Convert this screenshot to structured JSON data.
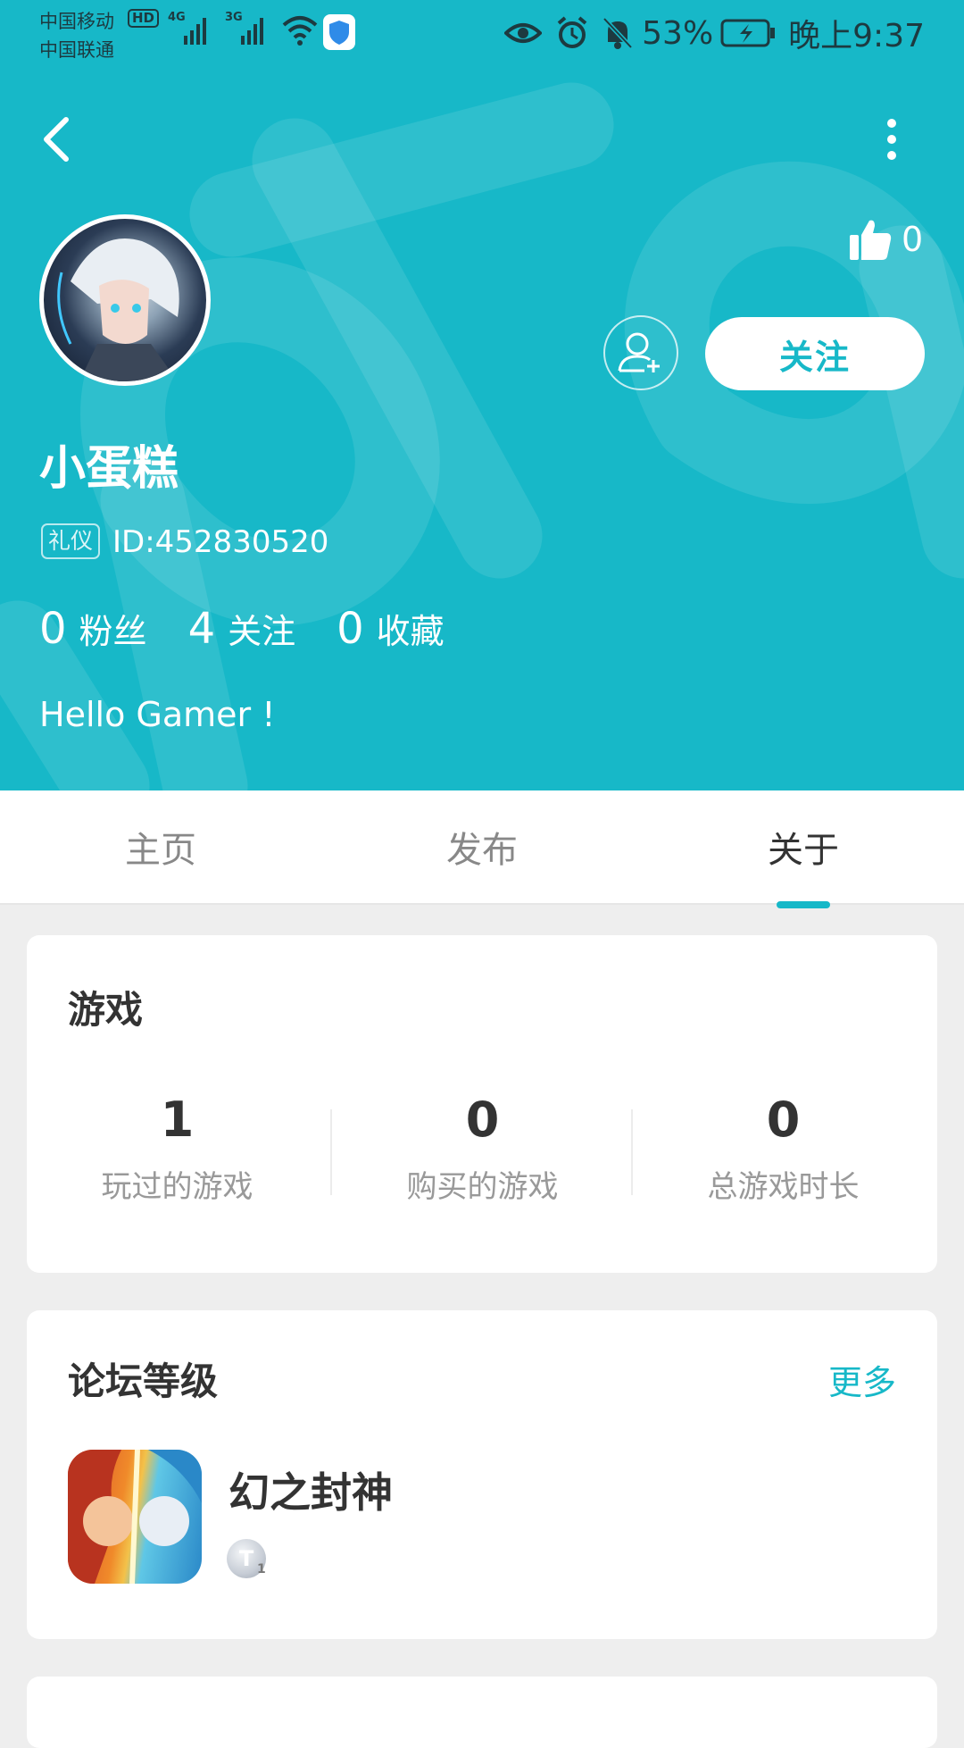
{
  "status_bar": {
    "carrier_primary": "中国移动",
    "carrier_secondary": "中国联通",
    "hd_label": "HD",
    "signal1_label": "4G",
    "signal2_label": "3G",
    "battery_percent": "53%",
    "time": "晚上9:37"
  },
  "profile": {
    "like_count": "0",
    "follow_button": "关注",
    "username": "小蛋糕",
    "badge": "礼仪",
    "user_id": "ID:452830520",
    "stats": [
      {
        "value": "0",
        "label": "粉丝"
      },
      {
        "value": "4",
        "label": "关注"
      },
      {
        "value": "0",
        "label": "收藏"
      }
    ],
    "bio": "Hello Gamer !"
  },
  "tabs": [
    {
      "label": "主页",
      "active": false
    },
    {
      "label": "发布",
      "active": false
    },
    {
      "label": "关于",
      "active": true
    }
  ],
  "games_card": {
    "title": "游戏",
    "stats": [
      {
        "value": "1",
        "label": "玩过的游戏"
      },
      {
        "value": "0",
        "label": "购买的游戏"
      },
      {
        "value": "0",
        "label": "总游戏时长"
      }
    ]
  },
  "forum_card": {
    "title": "论坛等级",
    "more_label": "更多",
    "game_name": "幻之封神",
    "level_letter": "T",
    "level_number": "1"
  },
  "colors": {
    "accent": "#17b8c8",
    "card_bg": "#ffffff",
    "page_bg": "#eeeeee"
  },
  "icons": [
    "back-icon",
    "more-icon",
    "thumbs-up-icon",
    "add-friend-icon",
    "eye-icon",
    "alarm-icon",
    "bell-off-icon",
    "battery-icon",
    "wifi-icon",
    "shield-icon"
  ]
}
